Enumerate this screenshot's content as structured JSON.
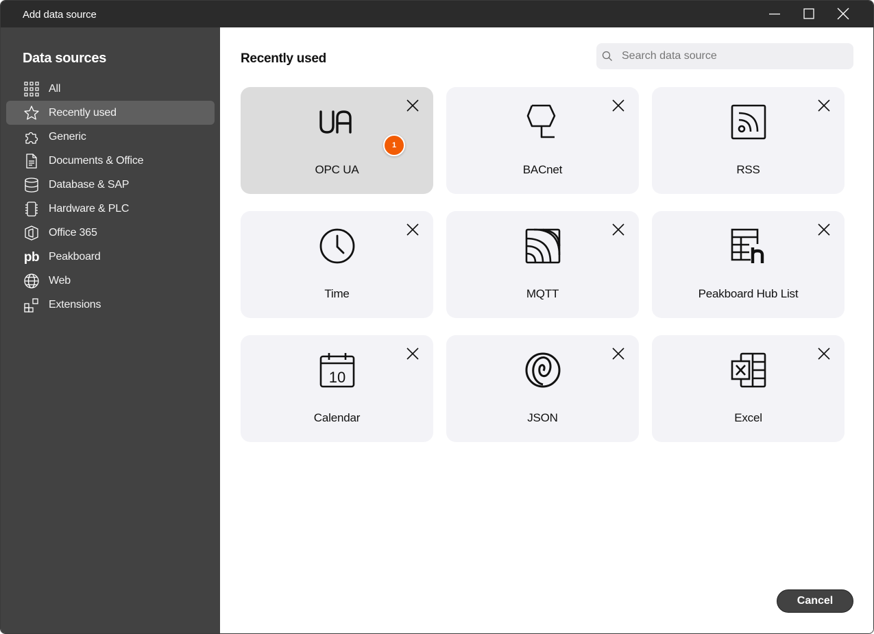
{
  "window": {
    "title": "Add data source",
    "controls": [
      "minimize-icon",
      "maximize-icon",
      "close-icon"
    ]
  },
  "sidebar": {
    "heading": "Data sources",
    "items": [
      {
        "label": "All",
        "icon": "grid-icon",
        "active": false
      },
      {
        "label": "Recently used",
        "icon": "star-icon",
        "active": true
      },
      {
        "label": "Generic",
        "icon": "puzzle-icon",
        "active": false
      },
      {
        "label": "Documents & Office",
        "icon": "document-icon",
        "active": false
      },
      {
        "label": "Database & SAP",
        "icon": "database-icon",
        "active": false
      },
      {
        "label": "Hardware & PLC",
        "icon": "chip-icon",
        "active": false
      },
      {
        "label": "Office 365",
        "icon": "office365-icon",
        "active": false
      },
      {
        "label": "Peakboard",
        "icon": "peakboard-icon",
        "icon_text": "pb",
        "active": false
      },
      {
        "label": "Web",
        "icon": "globe-icon",
        "active": false
      },
      {
        "label": "Extensions",
        "icon": "extensions-icon",
        "active": false
      }
    ]
  },
  "main": {
    "section_title": "Recently used",
    "search": {
      "placeholder": "Search data source",
      "value": ""
    },
    "cards": [
      {
        "label": "OPC UA",
        "icon": "opc-ua-icon",
        "icon_text": "UA",
        "selected": true,
        "badge": "1"
      },
      {
        "label": "BACnet",
        "icon": "bacnet-icon",
        "selected": false
      },
      {
        "label": "RSS",
        "icon": "rss-icon",
        "selected": false
      },
      {
        "label": "Time",
        "icon": "clock-icon",
        "selected": false
      },
      {
        "label": "MQTT",
        "icon": "mqtt-icon",
        "selected": false
      },
      {
        "label": "Peakboard Hub List",
        "icon": "hub-list-icon",
        "selected": false
      },
      {
        "label": "Calendar",
        "icon": "calendar-icon",
        "icon_text": "10",
        "selected": false
      },
      {
        "label": "JSON",
        "icon": "json-icon",
        "selected": false
      },
      {
        "label": "Excel",
        "icon": "excel-icon",
        "selected": false
      }
    ],
    "cancel_label": "Cancel"
  },
  "colors": {
    "titlebar": "#2b2b2b",
    "sidebar": "#424242",
    "sidebar_active": "#5f5f5f",
    "card": "#f3f3f7",
    "card_selected": "#dcdcdc",
    "badge": "#f25c05",
    "search_bg": "#efeff2"
  }
}
